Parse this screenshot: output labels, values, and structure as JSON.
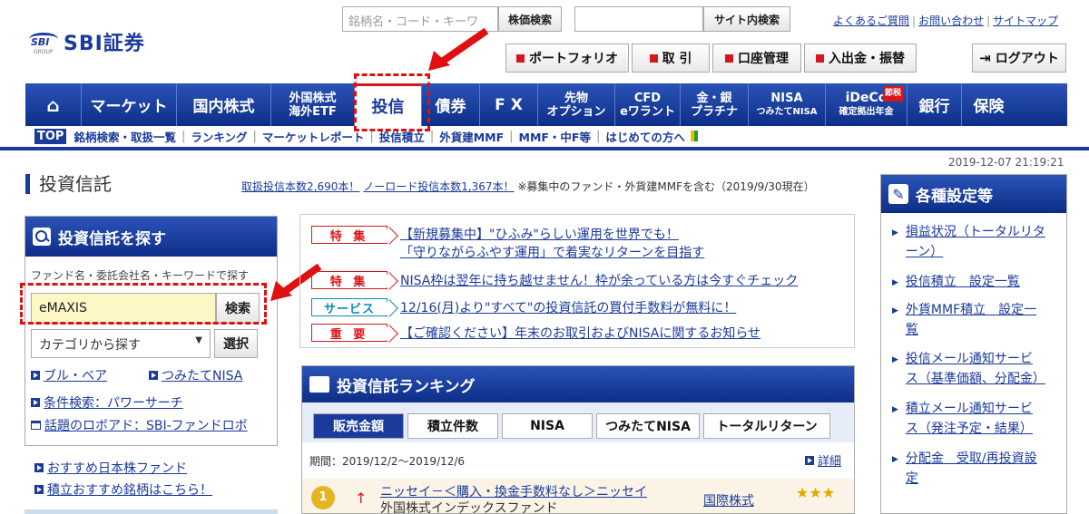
{
  "header": {
    "logo_mark": "SBI",
    "logo_group": "GROUP",
    "logo_text": "SBI証券",
    "stock_search_placeholder": "銘柄名・コード・キーワ",
    "stock_search_button": "株価検索",
    "site_search_button": "サイト内検索",
    "top_links": [
      "よくあるご質問",
      "お問い合わせ",
      "サイトマップ"
    ],
    "menu_buttons": [
      "ポートフォリオ",
      "取 引",
      "口座管理",
      "入出金・振替"
    ],
    "logout": "ログアウト"
  },
  "nav": {
    "home": "⌂",
    "items": [
      {
        "l1": "マーケット"
      },
      {
        "l1": "国内株式"
      },
      {
        "l1": "外国株式",
        "l2": "海外ETF"
      },
      {
        "l1": "投信"
      },
      {
        "l1": "債券"
      },
      {
        "l1": "F X"
      },
      {
        "l1": "先物",
        "l2": "オプション"
      },
      {
        "l1": "CFD",
        "l2": "eワラント"
      },
      {
        "l1": "金・銀",
        "l2": "プラチナ"
      },
      {
        "l1": "NISA",
        "l2": "つみたてNISA"
      },
      {
        "l1": "iDeCo",
        "l2": "確定拠出年金",
        "badge": "節税"
      },
      {
        "l1": "銀行"
      },
      {
        "l1": "保険"
      }
    ],
    "sub": [
      "TOP",
      "銘柄検索・取扱一覧",
      "ランキング",
      "マーケットレポート",
      "投信積立",
      "外貨建MMF",
      "MMF・中F等",
      "はじめての方へ"
    ]
  },
  "datetime": "2019-12-07 21:19:21",
  "page_title": "投資信託",
  "info": {
    "link1": "取扱投信本数2,690本！",
    "link2": "ノーロード投信本数1,367本！",
    "note": "※募集中のファンド・外貨建MMFを含む（2019/9/30現在）"
  },
  "search_panel": {
    "title": "投資信託を探す",
    "hint": "ファンド名・委託会社名・キーワードで探す",
    "input_value": "eMAXIS",
    "search_button": "検索",
    "category": "カテゴリから探す",
    "select_button": "選択",
    "links": [
      "ブル・ベア",
      "つみたてNISA",
      "条件検索：パワーサーチ",
      "話題のロボアド：SBI-ファンドロボ"
    ],
    "bottom_links": [
      "おすすめ日本株ファンド",
      "積立おすすめ銘柄はこちら！"
    ]
  },
  "news": [
    {
      "tag": "特 集",
      "l1": "【新規募集中】\"ひふみ\"らしい運用を世界でも！",
      "l2": "「守りながらふやす運用」で着実なリターンを目指す"
    },
    {
      "tag": "特 集",
      "l1": "NISA枠は翌年に持ち越せません！枠が余っている方は今すぐチェック"
    },
    {
      "tag": "サービス",
      "l1": "12/16(月)より\"すべて\"の投資信託の買付手数料が無料に！"
    },
    {
      "tag": "重 要",
      "l1": "【ご確認ください】年末のお取引およびNISAに関するお知らせ"
    }
  ],
  "ranking": {
    "title": "投資信託ランキング",
    "tabs": [
      "販売金額",
      "積立件数",
      "NISA",
      "つみたてNISA",
      "トータルリターン"
    ],
    "period": "期間：2019/12/2〜2019/12/6",
    "detail": "詳細",
    "row": {
      "rank": "1",
      "arrow": "↑",
      "name1": "ニッセイ－＜購入・換金手数料なし＞ニッセイ",
      "name2": "外国株式インデックスファンド",
      "category": "国際株式",
      "stars": "★★★"
    }
  },
  "settings": {
    "title": "各種設定等",
    "items": [
      [
        "損益状況（トータルリタ",
        "ーン）"
      ],
      [
        "投信積立　設定一覧"
      ],
      [
        "外貨MMF積立　設定一",
        "覧"
      ],
      [
        "投信メール通知サービ",
        "ス（基準価額、分配金）"
      ],
      [
        "積立メール通知サービ",
        "ス（発注予定・結果）"
      ],
      [
        "分配金　受取/再投資設",
        "定"
      ]
    ]
  }
}
